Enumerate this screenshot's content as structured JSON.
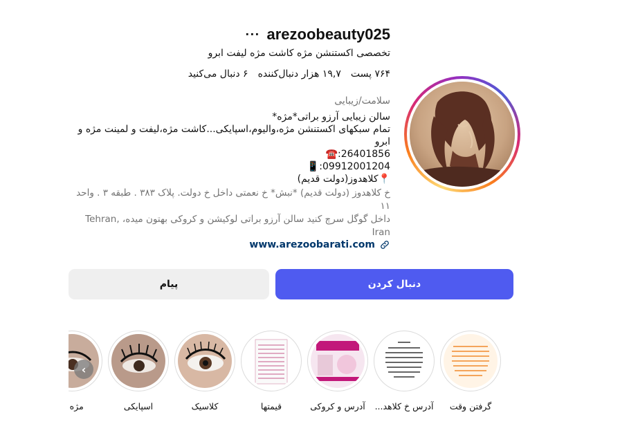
{
  "profile": {
    "username": "arezoobeauty025",
    "full_name": "تخصصی اکستنشن مژه کاشت مژه لیفت ابرو",
    "stats": {
      "posts": "۷۶۴ پست",
      "followers": "۱۹,۷ هزار دنبال‌کننده",
      "following": "۶ دنبال می‌کنید"
    },
    "category": "سلامت/زیبایی",
    "bio": {
      "line1": "سالن زیبایی آرزو براتی*مژه*",
      "line2": "تمام سبکهای اکستنشن مژه،والیوم،اسپایکی...کاشت مژه،لیفت و لمینت مژه و ابرو",
      "phone": "☎️:26401856",
      "mobile": "📱:09912001204",
      "location": "📍کلاهدوز(دولت قدیم)"
    },
    "address": {
      "line1": "خ کلاهدوز (دولت قدیم) *نبش* خ نعمتی داخل خ دولت. پلاک ۳۸۳ . طبقه ۳ . واحد ۱۱",
      "line2": "داخل گوگل سرچ کنید سالن آرزو براتی لوکیشن و کروکی بهتون میده، Tehran, Iran"
    },
    "website": "www.arezoobarati.com"
  },
  "buttons": {
    "follow": "دنبال کردن",
    "message": "پیام"
  },
  "highlights": [
    {
      "label": "گرفتن وقت"
    },
    {
      "label": "آدرس خ کلاهد..."
    },
    {
      "label": "آدرس و کروکی"
    },
    {
      "label": "قیمتها"
    },
    {
      "label": "کلاسیک"
    },
    {
      "label": "اسپایکی"
    },
    {
      "label": "مژه وا"
    }
  ],
  "colors": {
    "follow_button": "#4f5bf0",
    "message_button": "#efefef",
    "link": "#00376b",
    "secondary_text": "#737373"
  }
}
